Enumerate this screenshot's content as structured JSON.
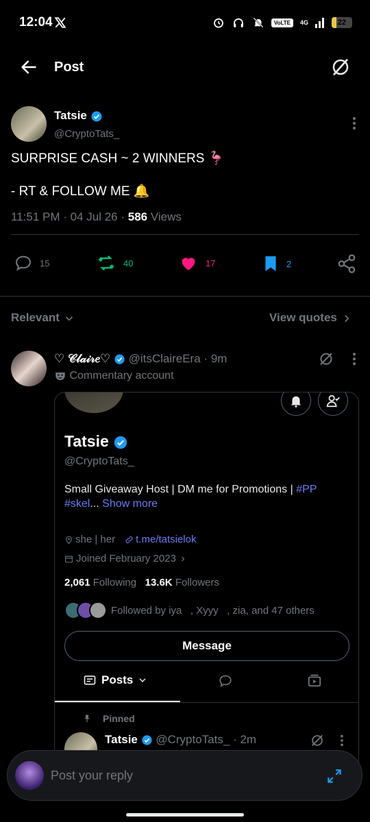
{
  "status_bar": {
    "time": "12:04",
    "network": "4G",
    "volte": "VoLTE",
    "battery": "22",
    "battery_level": 0.22
  },
  "header": {
    "title": "Post"
  },
  "post": {
    "author_name": "Tatsie",
    "author_handle": "@CryptoTats_",
    "line1": "SURPRISE CASH ~ 2 WINNERS 🦩",
    "line2": "- RT & FOLLOW ME 🔔",
    "time": "11:51 PM",
    "date": "04 Jul 26",
    "views_count": "586",
    "views_label": "Views",
    "replies": "15",
    "reposts": "40",
    "likes": "17",
    "bookmarks": "2"
  },
  "filter": {
    "label": "Relevant",
    "quotes_label": "View quotes"
  },
  "reply_item": {
    "name": "♡ 𝒞𝓁𝒶𝒾𝓇𝑒♡",
    "handle": "@itsClaireEra",
    "time": "9m",
    "badge": "Commentary account"
  },
  "profile_card": {
    "name": "Tatsie",
    "handle": "@CryptoTats_",
    "bio_text": "Small Giveaway Host | DM me for Promotions | ",
    "bio_tag1": "#PP",
    "bio_tag2": "#skel",
    "bio_ellipsis": "... ",
    "show_more": "Show more",
    "pronouns": "she | her",
    "link": "t.me/tatsielok",
    "joined": "Joined February 2023",
    "following_count": "2,061",
    "following_label": "Following",
    "followers_count": "13.6K",
    "followers_label": "Followers",
    "followed_by": "Followed by iya   , Xyyy   , zia, and 47 others",
    "message_button": "Message",
    "tab_posts": "Posts",
    "pinned_label": "Pinned",
    "pinned_name": "Tatsie",
    "pinned_handle": "@CryptoTats_",
    "pinned_time": "2m"
  },
  "reply_bar": {
    "placeholder": "Post your reply"
  },
  "colors": {
    "accent": "#1d9bf0",
    "repost": "#00ba7c",
    "like": "#f91880",
    "link": "#6a7bf5"
  }
}
